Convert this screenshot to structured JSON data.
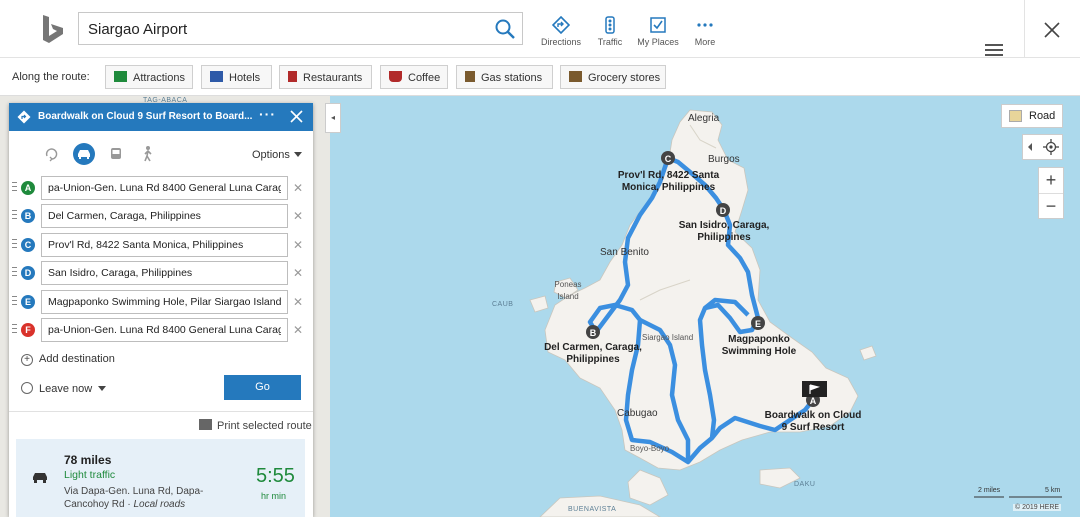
{
  "search": {
    "value": "Siargao Airport"
  },
  "toolbar": {
    "directions": "Directions",
    "traffic": "Traffic",
    "my_places": "My Places",
    "more": "More"
  },
  "route_bar": {
    "label": "Along the route:",
    "chips": [
      "Attractions",
      "Hotels",
      "Restaurants",
      "Coffee",
      "Gas stations",
      "Grocery stores"
    ]
  },
  "panel": {
    "title": "Boardwalk on Cloud 9 Surf Resort to Board...",
    "options": "Options",
    "waypoints": [
      {
        "letter": "A",
        "color": "#1f8a3c",
        "value": "pa-Union-Gen. Luna Rd 8400 General Luna Caraga"
      },
      {
        "letter": "B",
        "color": "#2579bd",
        "value": "Del Carmen, Caraga, Philippines"
      },
      {
        "letter": "C",
        "color": "#2579bd",
        "value": "Prov'l Rd, 8422 Santa Monica, Philippines"
      },
      {
        "letter": "D",
        "color": "#2579bd",
        "value": "San Isidro, Caraga, Philippines"
      },
      {
        "letter": "E",
        "color": "#2579bd",
        "value": "Magpaponko Swimming Hole, Pilar Siargao Island"
      },
      {
        "letter": "F",
        "color": "#d9322b",
        "value": "pa-Union-Gen. Luna Rd 8400 General Luna Caraga"
      }
    ],
    "add_destination": "Add destination",
    "leave_now": "Leave now",
    "go": "Go",
    "print": "Print selected route",
    "summary": {
      "distance": "78 miles",
      "traffic": "Light traffic",
      "via": "Via Dapa-Gen. Luna Rd, Dapa-Cancohoy Rd",
      "via_suffix": "Local roads",
      "time": "5:55",
      "time_unit": "hr min"
    }
  },
  "map": {
    "view": "Road",
    "labels": {
      "alegria": "Alegria",
      "burgos": "Burgos",
      "c_label": "Prov'l Rd, 8422 Santa Monica, Philippines",
      "d_label": "San Isidro, Caraga, Philippines",
      "san_benito": "San Benito",
      "poneas": "Poneas Island",
      "caub": "CAUB",
      "siargao": "Siargao Island",
      "b_label": "Del Carmen, Caraga, Philippines",
      "e_label": "Magpaponko Swimming Hole",
      "a_label": "Boardwalk on Cloud 9 Surf Resort",
      "cabugao": "Cabugao",
      "boyo": "Boyo-Boyo",
      "daku": "DAKU",
      "buenavista": "BUENAVISTA",
      "tag_abaca": "TAG-ABACA"
    },
    "scale": {
      "miles": "2 miles",
      "km": "5 km"
    },
    "copyright": "© 2019 HERE"
  },
  "colors": {
    "accent": "#2579bd",
    "route": "#3b8fe0",
    "water": "#acd9ec",
    "land": "#f2f0ec",
    "traffic_green": "#1f8a3c"
  }
}
